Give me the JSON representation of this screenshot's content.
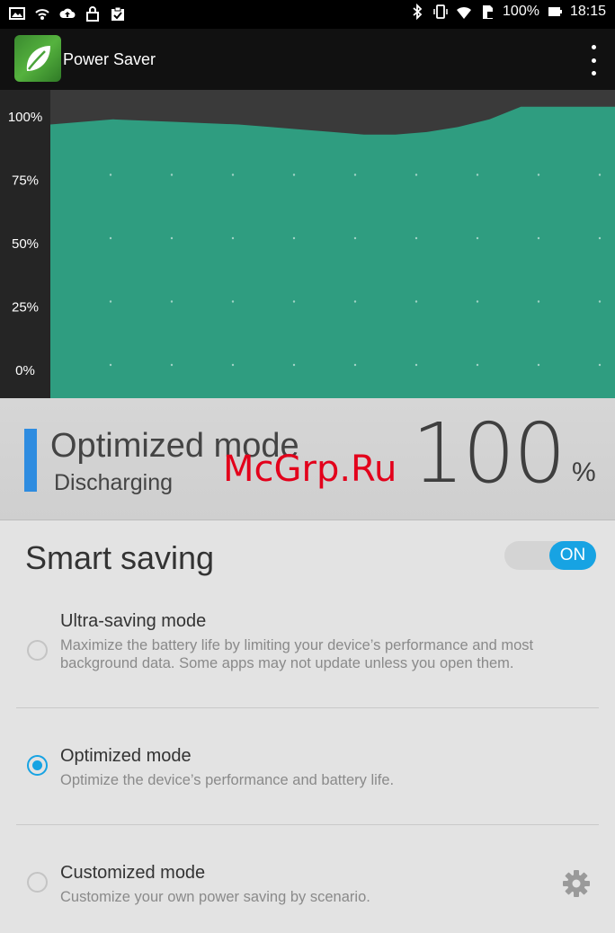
{
  "status_bar": {
    "battery": "100%",
    "time": "18:15",
    "left_icons": [
      "image-icon",
      "hotspot-icon",
      "cloud-upload-icon",
      "lock-icon",
      "clipboard-icon"
    ],
    "right_icons": [
      "bluetooth-icon",
      "vibrate-icon",
      "wifi-icon",
      "sd-card-icon",
      "battery-icon"
    ]
  },
  "app_bar": {
    "title": "Power Saver",
    "logo_icon": "leaf-icon",
    "menu_icon": "overflow-menu-icon"
  },
  "chart_data": {
    "type": "area",
    "y_tick_labels": [
      "100%",
      "75%",
      "50%",
      "25%",
      "0%"
    ],
    "ylim": [
      0,
      100
    ],
    "series": [
      {
        "values": [
          97,
          98,
          99,
          98.5,
          98,
          97.5,
          97,
          96,
          95,
          94,
          93,
          93,
          94,
          96,
          99,
          104,
          104,
          104,
          104
        ]
      }
    ],
    "fill_color": "#2f9d80",
    "background_color": "#252525"
  },
  "summary": {
    "mode_name": "Optimized mode",
    "mode_state": "Discharging",
    "battery_value": "100",
    "battery_unit": "%",
    "mode_color": "#2e8ce0",
    "watermark": "McGrp.Ru"
  },
  "smart_saving": {
    "title": "Smart saving",
    "toggle_label": "ON",
    "toggle_on": true
  },
  "options": [
    {
      "title": "Ultra-saving mode",
      "description": "Maximize the battery life by limiting your device’s performance and most background data. Some apps may not update unless you open them.",
      "selected": false
    },
    {
      "title": "Optimized mode",
      "description": "Optimize the device’s performance and battery life.",
      "selected": true
    },
    {
      "title": "Customized mode",
      "description": "Customize your own power saving by scenario.",
      "selected": false,
      "icon": "gear-icon"
    }
  ],
  "accent_color": "#17a3e3"
}
